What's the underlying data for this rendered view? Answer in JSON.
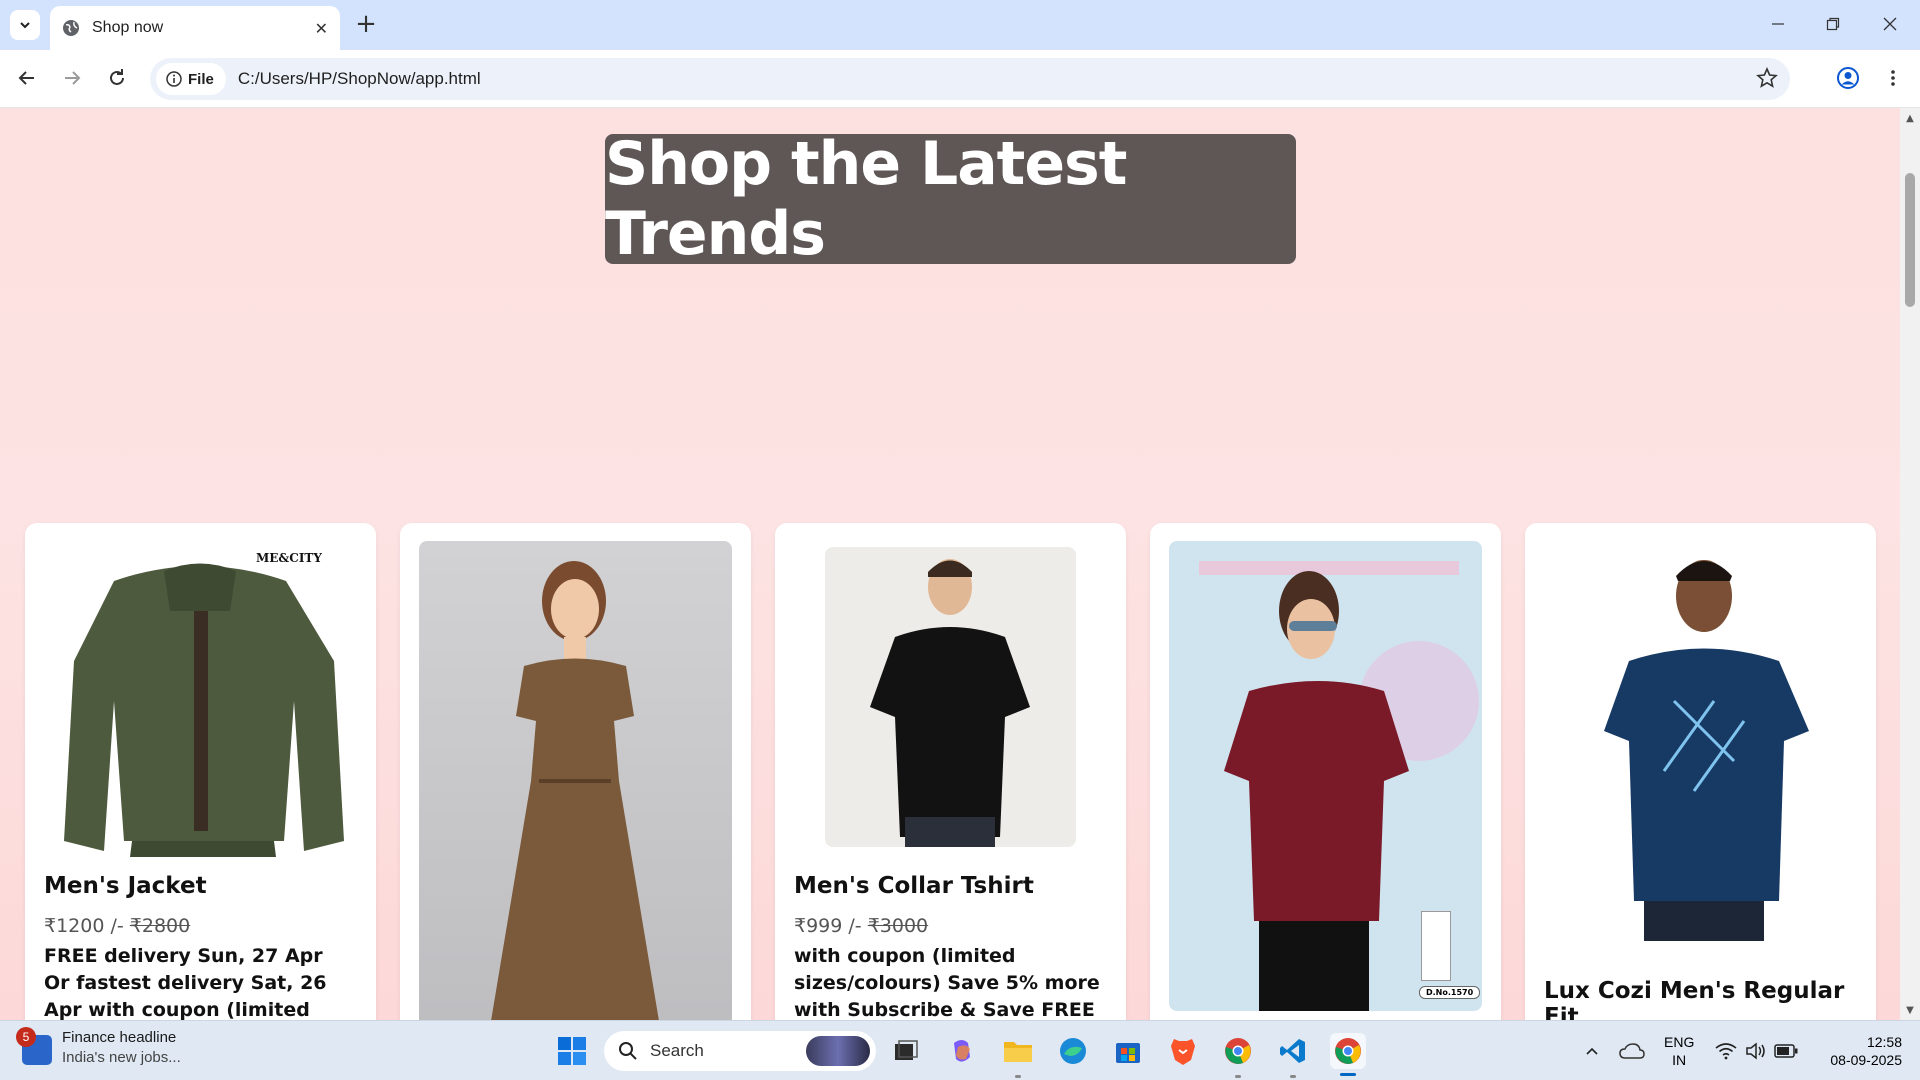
{
  "browser": {
    "tab_title": "Shop now",
    "url_chip": "File",
    "url": "C:/Users/HP/ShopNow/app.html"
  },
  "page": {
    "hero_title": "Shop the Latest Trends",
    "products": [
      {
        "name": "Men's Jacket",
        "price": "₹1200 /-",
        "old_price": "₹2800",
        "desc": "FREE delivery Sun, 27 Apr Or fastest delivery Sat, 26 Apr with coupon (limited",
        "brand_mark": "ME&CITY"
      },
      {
        "name": "",
        "price": "",
        "old_price": "",
        "desc": ""
      },
      {
        "name": "Men's Collar Tshirt",
        "price": "₹999 /-",
        "old_price": "₹3000",
        "desc": "with coupon (limited sizes/colours) Save 5% more with Subscribe & Save FREE"
      },
      {
        "name": "",
        "price": "",
        "old_price": "",
        "desc": "",
        "tag_label": "D.No.1570"
      },
      {
        "name": "Lux Cozi Men's Regular Fit",
        "price": "",
        "old_price": "",
        "desc": ""
      }
    ]
  },
  "taskbar": {
    "news_badge": "5",
    "news_title": "Finance headline",
    "news_sub": "India's new jobs...",
    "search_label": "Search",
    "lang_top": "ENG",
    "lang_bottom": "IN",
    "time": "12:58",
    "date": "08-09-2025"
  },
  "colors": {
    "hero_bg": "#5f5656",
    "page_bg": "#fde0e0",
    "tabstrip_bg": "#d3e3fd"
  }
}
